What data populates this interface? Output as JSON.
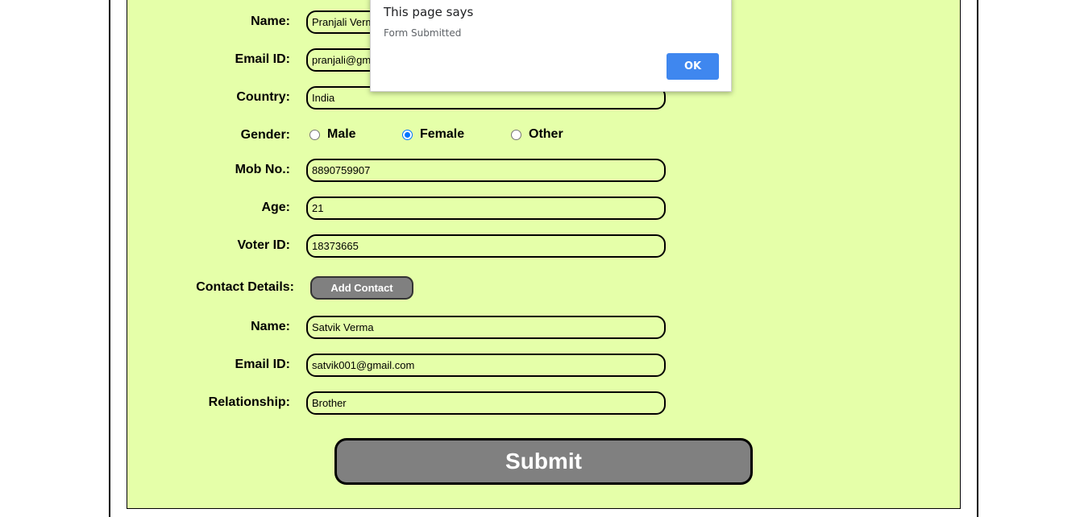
{
  "form": {
    "name_label": "Name:",
    "name_value": "Pranjali Verma",
    "email_label": "Email ID:",
    "email_value": "pranjali@gmail.com",
    "country_label": "Country:",
    "country_value": "India",
    "gender_label": "Gender:",
    "gender_options": [
      "Male",
      "Female",
      "Other"
    ],
    "gender_selected": "Female",
    "mobile_label": "Mob No.:",
    "mobile_value": "8890759907",
    "age_label": "Age:",
    "age_value": "21",
    "voter_label": "Voter ID:",
    "voter_value": "18373665",
    "contact_details_label": "Contact Details:",
    "add_contact_label": "Add Contact",
    "contact": {
      "name_label": "Name:",
      "name_value": "Satvik Verma",
      "email_label": "Email ID:",
      "email_value": "satvik001@gmail.com",
      "relationship_label": "Relationship:",
      "relationship_value": "Brother"
    },
    "submit_label": "Submit"
  },
  "dialog": {
    "title": "This page says",
    "message": "Form Submitted",
    "ok_label": "OK"
  },
  "colors": {
    "form_background": "#e5ffa9",
    "button_gray": "#808080",
    "dialog_ok_blue": "#3f87ef",
    "radio_accent": "#0075ff"
  }
}
